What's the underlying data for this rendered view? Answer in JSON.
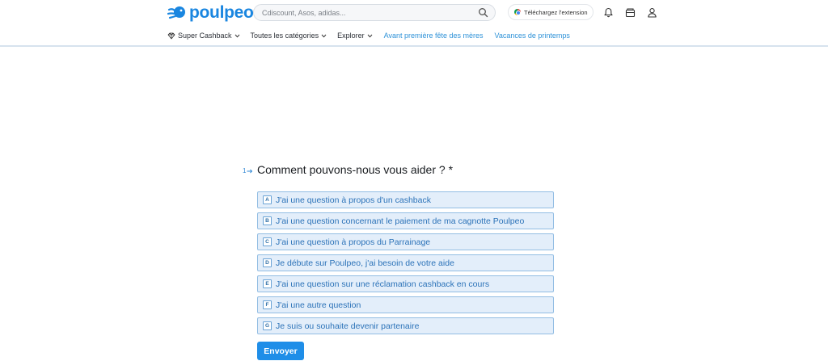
{
  "header": {
    "logo_text": "poulpeo",
    "search": {
      "placeholder": "Cdiscount, Asos, adidas...",
      "value": ""
    },
    "extension_button_label": "Téléchargez l'extension",
    "icons": [
      "bell-icon",
      "wallet-icon",
      "user-icon"
    ]
  },
  "nav": {
    "items": [
      {
        "label": "Super Cashback",
        "has_dropdown": true,
        "icon": "diamond-icon"
      },
      {
        "label": "Toutes les catégories",
        "has_dropdown": true
      },
      {
        "label": "Explorer",
        "has_dropdown": true
      },
      {
        "label": "Avant première fête des mères",
        "has_dropdown": false
      },
      {
        "label": "Vacances de printemps",
        "has_dropdown": false
      }
    ]
  },
  "form": {
    "question_number": "1",
    "question": "Comment pouvons-nous vous aider ? *",
    "options": [
      {
        "key": "A",
        "label": "J'ai une question à propos d'un cashback"
      },
      {
        "key": "B",
        "label": "J'ai une question concernant le paiement de ma cagnotte Poulpeo"
      },
      {
        "key": "C",
        "label": "J'ai une question à propos du Parrainage"
      },
      {
        "key": "D",
        "label": "Je débute sur Poulpeo, j'ai besoin de votre aide"
      },
      {
        "key": "E",
        "label": "J'ai une question sur une réclamation cashback en cours"
      },
      {
        "key": "F",
        "label": "J'ai une autre question"
      },
      {
        "key": "G",
        "label": "Je suis ou souhaite devenir partenaire"
      }
    ],
    "submit_label": "Envoyer"
  },
  "colors": {
    "brand": "#1a86e0",
    "option_bg": "#e3eefa",
    "option_border": "#92bde3",
    "option_text": "#2b72b8",
    "button": "#1f8ee8",
    "nav_link": "#2e92d8"
  }
}
